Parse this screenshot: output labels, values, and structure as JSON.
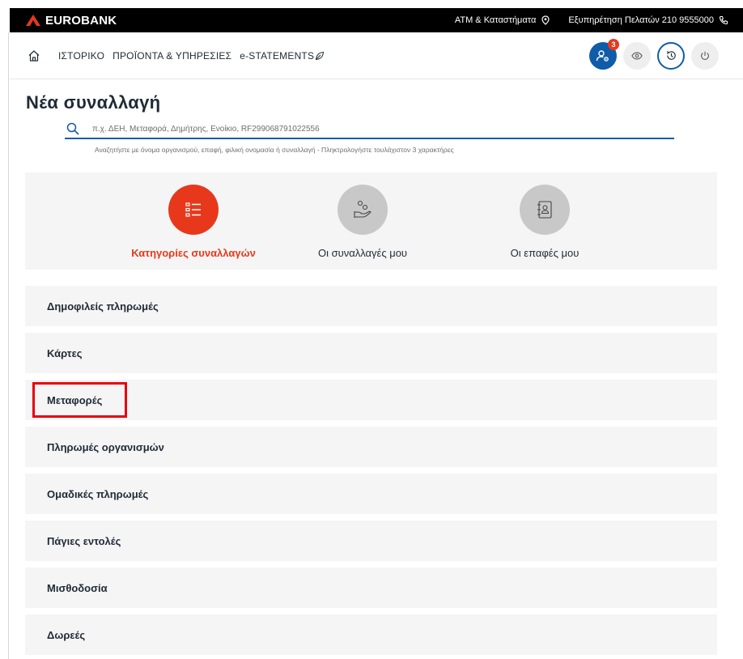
{
  "header": {
    "brand": "EUROBANK",
    "atm_link": "ATM & Καταστήματα",
    "support_link": "Εξυπηρέτηση Πελατών 210 9555000",
    "colors": {
      "brand_red": "#e8381b",
      "brand_blue": "#0f5ca8",
      "bar": "#000000"
    }
  },
  "nav": {
    "items": [
      "ΙΣΤΟΡΙΚΟ",
      "ΠΡΟΪΟΝΤΑ & ΥΠΗΡΕΣΙΕΣ",
      "e-STATEMENTS"
    ],
    "notification_count": "3",
    "icons": [
      "home-icon",
      "user-settings-icon",
      "eye-icon",
      "history-icon",
      "power-icon",
      "leaf-icon"
    ]
  },
  "page": {
    "title": "Νέα συναλλαγή"
  },
  "search": {
    "placeholder": "π.χ. ΔΕΗ, Μεταφορά, Δημήτρης, Ενοίκιο, RF299068791022556",
    "hint": "Αναζητήστε με όνομα οργανισμού, επαφή, φιλική ονομασία ή συναλλαγή - Πληκτρολογήστε τουλάχιστον 3 χαρακτήρες"
  },
  "tabs": [
    {
      "label": "Κατηγορίες συναλλαγών",
      "icon": "list-icon",
      "active": true
    },
    {
      "label": "Οι συναλλαγές μου",
      "icon": "hand-coins-icon",
      "active": false
    },
    {
      "label": "Οι επαφές μου",
      "icon": "contacts-book-icon",
      "active": false
    }
  ],
  "categories": [
    "Δημοφιλείς πληρωμές",
    "Κάρτες",
    "Μεταφορές",
    "Πληρωμές οργανισμών",
    "Ομαδικές πληρωμές",
    "Πάγιες εντολές",
    "Μισθοδοσία",
    "Δωρεές"
  ]
}
